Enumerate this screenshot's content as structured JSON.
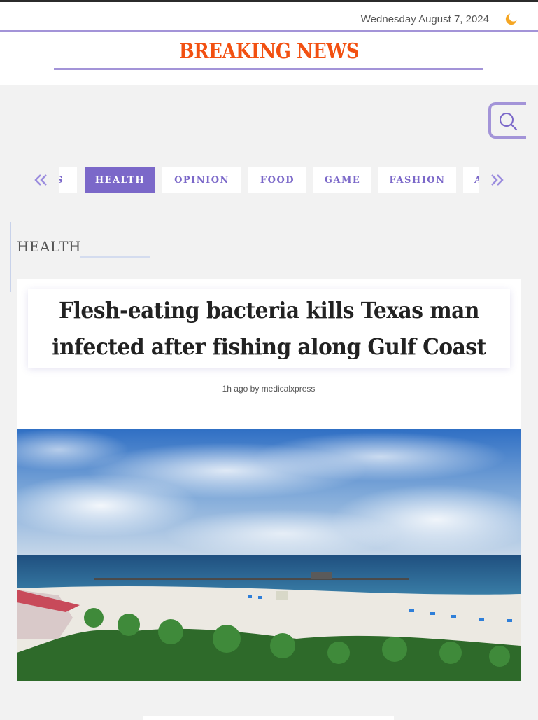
{
  "header": {
    "date": "Wednesday August 7, 2024",
    "theme_toggle_icon": "moon-icon",
    "brand": "BREAKING NEWS"
  },
  "search": {
    "icon": "search-icon"
  },
  "categories": {
    "prev_icon": "double-chevron-left-icon",
    "next_icon": "double-chevron-right-icon",
    "items": [
      {
        "label": "S"
      },
      {
        "label": "HEALTH",
        "active": true
      },
      {
        "label": "OPINION"
      },
      {
        "label": "FOOD"
      },
      {
        "label": "GAME"
      },
      {
        "label": "FASHION"
      },
      {
        "label": "A"
      }
    ]
  },
  "section": {
    "title": "HEALTH"
  },
  "article": {
    "headline": "Flesh-eating bacteria kills Texas man infected after fishing along Gulf Coast",
    "meta": "1h ago by medicalxpress"
  },
  "colors": {
    "accent": "#a394d8",
    "active_tab": "#7b68c9",
    "brand": "#f25011",
    "moon": "#f5a623"
  }
}
